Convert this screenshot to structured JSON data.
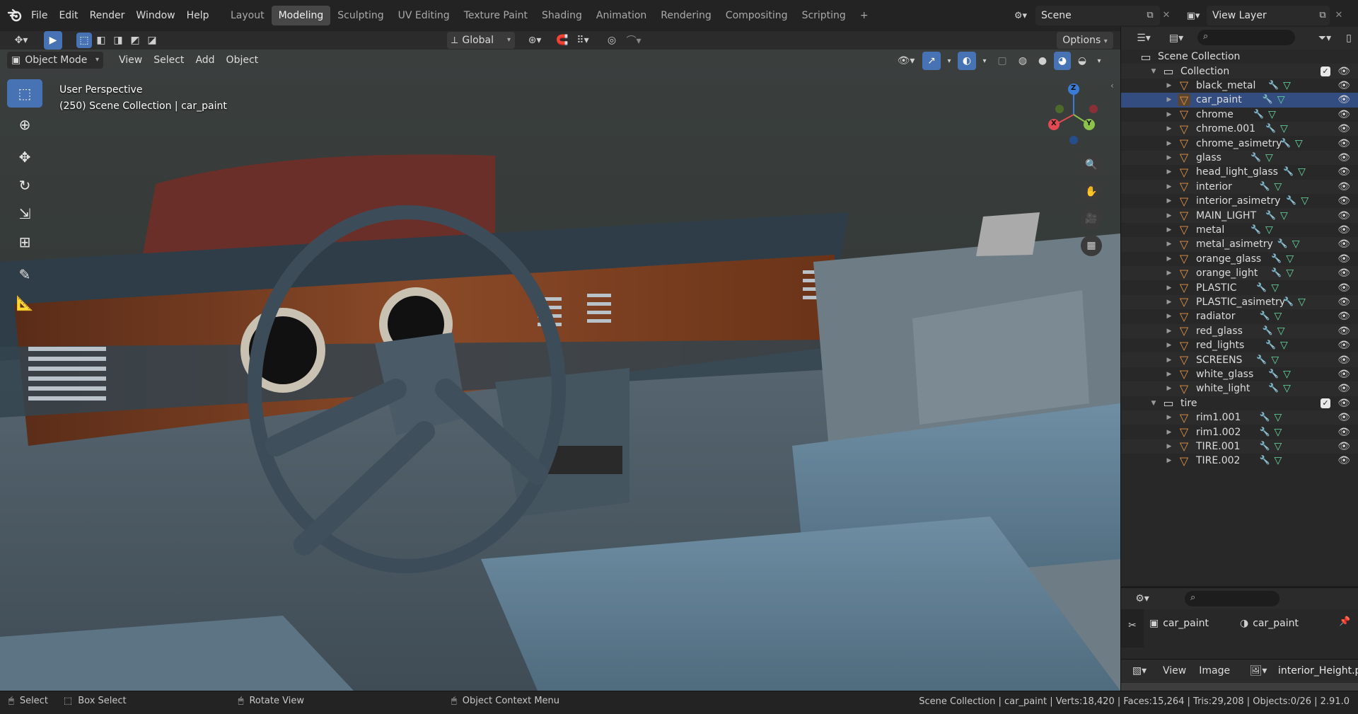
{
  "app_menu": [
    "File",
    "Edit",
    "Render",
    "Window",
    "Help"
  ],
  "workspaces": [
    {
      "label": "Layout",
      "active": false
    },
    {
      "label": "Modeling",
      "active": true
    },
    {
      "label": "Sculpting",
      "active": false
    },
    {
      "label": "UV Editing",
      "active": false
    },
    {
      "label": "Texture Paint",
      "active": false
    },
    {
      "label": "Shading",
      "active": false
    },
    {
      "label": "Animation",
      "active": false
    },
    {
      "label": "Rendering",
      "active": false
    },
    {
      "label": "Compositing",
      "active": false
    },
    {
      "label": "Scripting",
      "active": false
    }
  ],
  "add_workspace": "+",
  "scene": {
    "label": "Scene"
  },
  "view_layer": {
    "label": "View Layer"
  },
  "tool_header": {
    "orientation": "Global",
    "options": "Options"
  },
  "viewport_header": {
    "mode": "Object Mode",
    "menus": [
      "View",
      "Select",
      "Add",
      "Object"
    ]
  },
  "viewport": {
    "perspective": "User Perspective",
    "context": "(250) Scene Collection | car_paint",
    "gizmo": {
      "x": "X",
      "y": "Y",
      "z": "Z"
    }
  },
  "outliner": {
    "search_placeholder": "",
    "scene_collection": "Scene Collection",
    "collections": [
      {
        "name": "Collection",
        "items": [
          "black_metal",
          "car_paint",
          "chrome",
          "chrome.001",
          "chrome_asimetry",
          "glass",
          "head_light_glass",
          "interior",
          "interior_asimetry",
          "MAIN_LIGHT",
          "metal",
          "metal_asimetry",
          "orange_glass",
          "orange_light",
          "PLASTIC",
          "PLASTIC_asimetry",
          "radiator",
          "red_glass",
          "red_lights",
          "SCREENS",
          "white_glass",
          "white_light"
        ]
      },
      {
        "name": "tire",
        "items": [
          "rim1.001",
          "rim1.002",
          "TIRE.001",
          "TIRE.002"
        ]
      }
    ],
    "selected": "car_paint"
  },
  "properties": {
    "object": "car_paint",
    "material": "car_paint"
  },
  "image_editor": {
    "menus": [
      "View",
      "Image"
    ],
    "image": "interior_Height.png"
  },
  "status_bar": {
    "select": "Select",
    "box_select": "Box Select",
    "rotate": "Rotate View",
    "context_menu": "Object Context Menu",
    "stats": "Scene Collection | car_paint | Verts:18,420 | Faces:15,264 | Tris:29,208 | Objects:0/26 | 2.91.0"
  },
  "colors": {
    "accent": "#4772b3",
    "object_icon": "#e59443",
    "modifier": "#6fb0ff",
    "mesh_data": "#66d9a0",
    "selected_row": "#334d80"
  }
}
